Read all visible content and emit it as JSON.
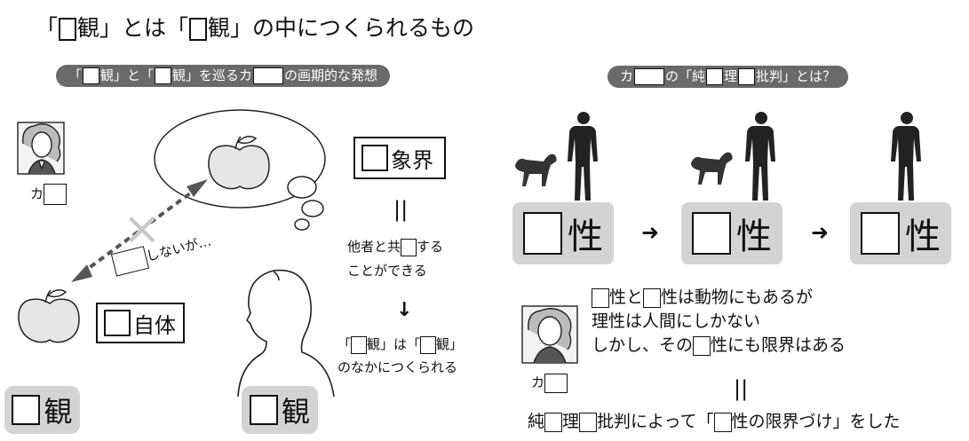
{
  "title": {
    "p1": "「",
    "p2": "観」とは「",
    "p3": "観」の中につくられるもの"
  },
  "left_banner": {
    "p1": "「",
    "p2": "観」と「",
    "p3": "観」を巡るカ",
    "p4": "の画期的な発想"
  },
  "right_banner": {
    "p1": "カ",
    "p2": "の「純",
    "p3": "理",
    "p4": "批判」とは？"
  },
  "kant_label": "カ",
  "phenomenon_box": "象界",
  "parallel_mark": "||",
  "share_text": {
    "p1": "他者と共",
    "p2": "する",
    "p3": "ことができる"
  },
  "down_arrow": "↓",
  "created_text": {
    "p1": "「",
    "p2": "観」は「",
    "p3": "観」",
    "p4": "のなかにつくられる"
  },
  "cross_mark": "×",
  "not_but_text": "しないが…",
  "thing_itself": "自体",
  "left_bottom_label": "観",
  "right_bottom_label": "観",
  "faculties": [
    "性",
    "性",
    "性"
  ],
  "right_arrow": "➜",
  "explanation": {
    "l1a": "性と",
    "l1b": "性は動物にもあるが",
    "l2": "理性は人間にしかない",
    "l3a": "しかし、その",
    "l3b": "性にも限界はある"
  },
  "conclusion": {
    "p1": "純",
    "p2": "理",
    "p3": "批判によって「",
    "p4": "性の限界づけ」をした"
  }
}
